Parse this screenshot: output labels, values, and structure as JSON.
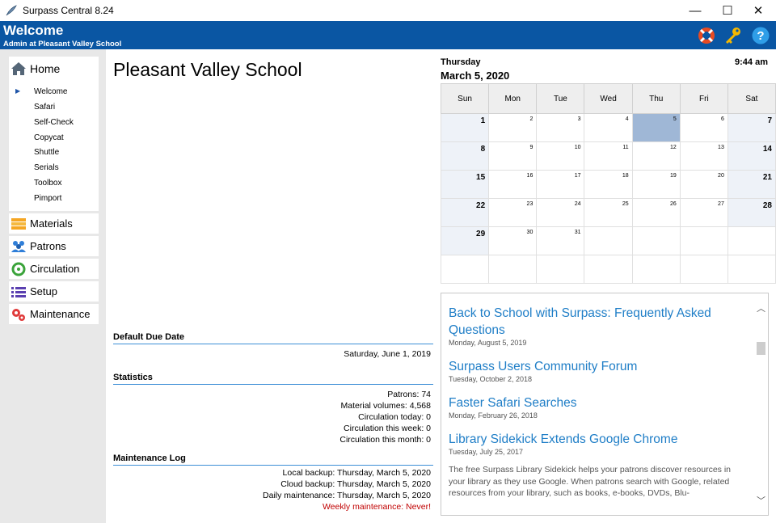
{
  "window": {
    "title": "Surpass Central 8.24",
    "minimize": "—",
    "maximize": "☐",
    "close": "✕"
  },
  "header": {
    "title": "Welcome",
    "subtitle": "Admin at Pleasant Valley School"
  },
  "sidebar": {
    "home": {
      "label": "Home",
      "items": [
        "Welcome",
        "Safari",
        "Self-Check",
        "Copycat",
        "Shuttle",
        "Serials",
        "Toolbox",
        "Pimport"
      ],
      "selected": "Welcome"
    },
    "sections": [
      "Materials",
      "Patrons",
      "Circulation",
      "Setup",
      "Maintenance"
    ]
  },
  "main": {
    "school": "Pleasant Valley School",
    "due_date": {
      "heading": "Default Due Date",
      "value": "Saturday, June 1, 2019"
    },
    "statistics": {
      "heading": "Statistics",
      "lines": [
        "Patrons: 74",
        "Material volumes: 4,568",
        "Circulation today: 0",
        "Circulation this week: 0",
        "Circulation this month: 0"
      ]
    },
    "maintenance": {
      "heading": "Maintenance Log",
      "lines": [
        "Local backup: Thursday, March 5, 2020",
        "Cloud backup: Thursday, March 5, 2020",
        "Daily maintenance: Thursday, March 5, 2020"
      ],
      "warning": "Weekly maintenance: Never!"
    }
  },
  "calendar": {
    "day": "Thursday",
    "date": "March 5, 2020",
    "time": "9:44 am",
    "weekdays": [
      "Sun",
      "Mon",
      "Tue",
      "Wed",
      "Thu",
      "Fri",
      "Sat"
    ],
    "weeks": [
      [
        "1",
        "2",
        "3",
        "4",
        "5",
        "6",
        "7"
      ],
      [
        "8",
        "9",
        "10",
        "11",
        "12",
        "13",
        "14"
      ],
      [
        "15",
        "16",
        "17",
        "18",
        "19",
        "20",
        "21"
      ],
      [
        "22",
        "23",
        "24",
        "25",
        "26",
        "27",
        "28"
      ],
      [
        "29",
        "30",
        "31",
        "",
        "",
        "",
        ""
      ],
      [
        "",
        "",
        "",
        "",
        "",
        "",
        ""
      ]
    ],
    "today": "5"
  },
  "news": [
    {
      "title": "Back to School with Surpass: Frequently Asked Questions",
      "date": "Monday, August 5, 2019"
    },
    {
      "title": "Surpass Users Community Forum",
      "date": "Tuesday, October 2, 2018"
    },
    {
      "title": "Faster Safari Searches",
      "date": "Monday, February 26, 2018"
    },
    {
      "title": "Library Sidekick Extends Google Chrome",
      "date": "Tuesday, July 25, 2017"
    }
  ],
  "news_body": "The free Surpass Library Sidekick helps your patrons discover resources in your library as they use Google. When patrons search with Google, related resources from your library, such as books, e-books, DVDs, Blu-",
  "colors": {
    "header": "#0a56a3",
    "accent_link": "#1f7ec7",
    "today": "#9fb7d6",
    "warning": "#c00000"
  },
  "icons": [
    "app-feather-icon",
    "lifebuoy-icon",
    "key-icon",
    "help-icon",
    "home-icon",
    "materials-icon",
    "patrons-icon",
    "circulation-icon",
    "setup-icon",
    "maintenance-icon"
  ]
}
